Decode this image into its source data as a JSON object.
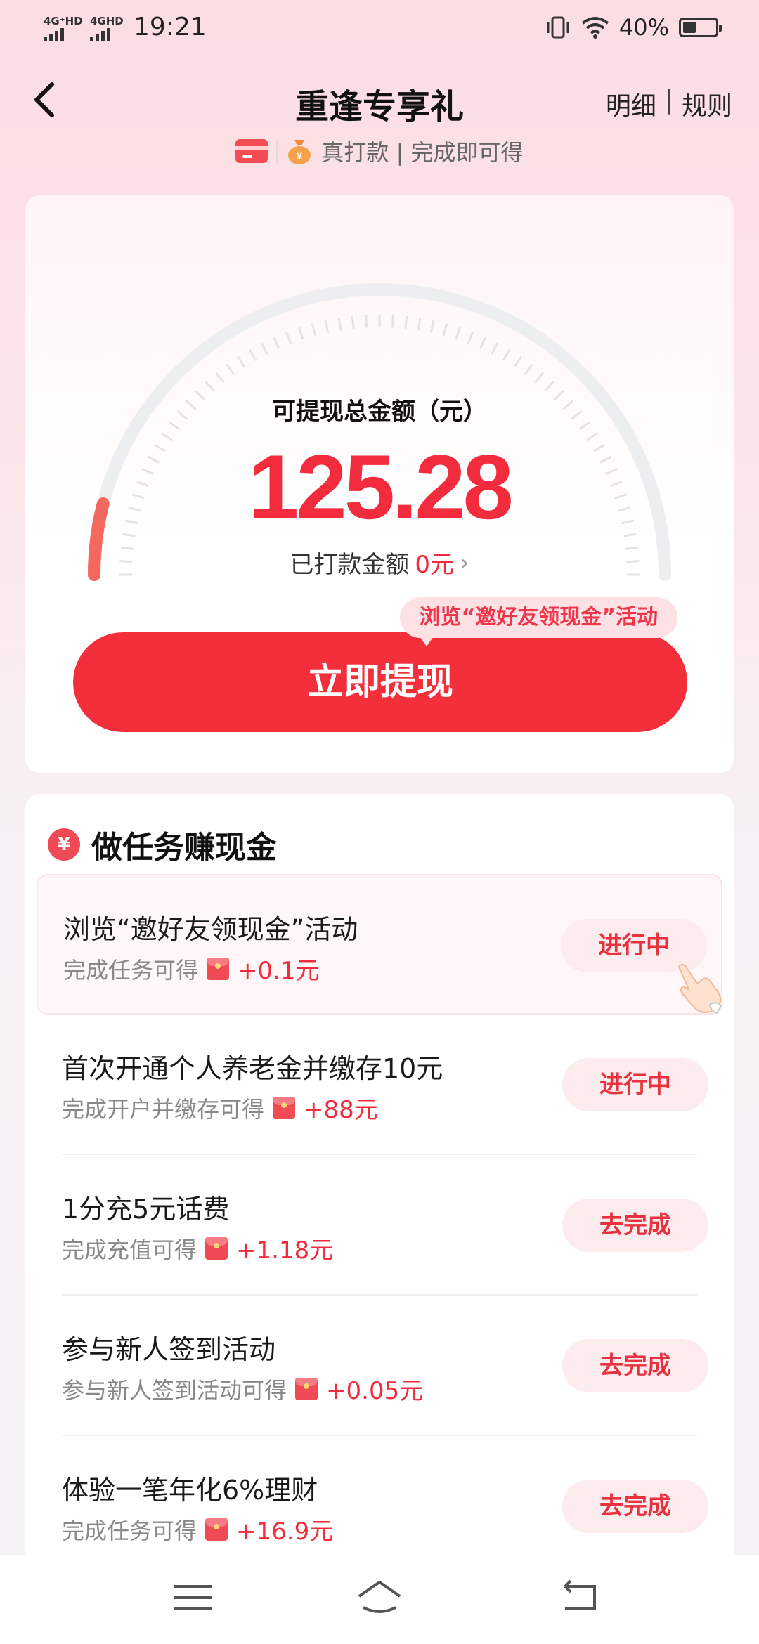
{
  "status_bar": {
    "signal1_label": "4G⁺HD",
    "signal2_label": "4GHD",
    "time": "19:21",
    "battery": "40%"
  },
  "header": {
    "title": "重逢专享礼",
    "link_detail": "明细",
    "link_sep": "|",
    "link_rules": "规则",
    "subtitle": "真打款 | 完成即可得"
  },
  "balance": {
    "label": "可提现总金额（元）",
    "value": "125.28",
    "paid_label": "已打款金额",
    "paid_amount": "0元",
    "progress": 0.08,
    "bubble": "浏览“邀好友领现金”活动",
    "withdraw_label": "立即提现"
  },
  "tasks": {
    "title": "做任务赚现金",
    "items": [
      {
        "title": "浏览“邀好友领现金”活动",
        "desc": "完成任务可得",
        "reward": "+0.1元",
        "button": "进行中"
      },
      {
        "title": "首次开通个人养老金并缴存10元",
        "desc": "完成开户并缴存可得",
        "reward": "+88元",
        "button": "进行中"
      },
      {
        "title": "1分充5元话费",
        "desc": "完成充值可得",
        "reward": "+1.18元",
        "button": "去完成"
      },
      {
        "title": "参与新人签到活动",
        "desc": "参与新人签到活动可得",
        "reward": "+0.05元",
        "button": "去完成"
      },
      {
        "title": "体验一笔年化6%理财",
        "desc": "完成任务可得",
        "reward": "+16.9元",
        "button": "去完成"
      }
    ]
  },
  "colors": {
    "accent": "#f42f3c",
    "button_bg": "#fdecee"
  }
}
